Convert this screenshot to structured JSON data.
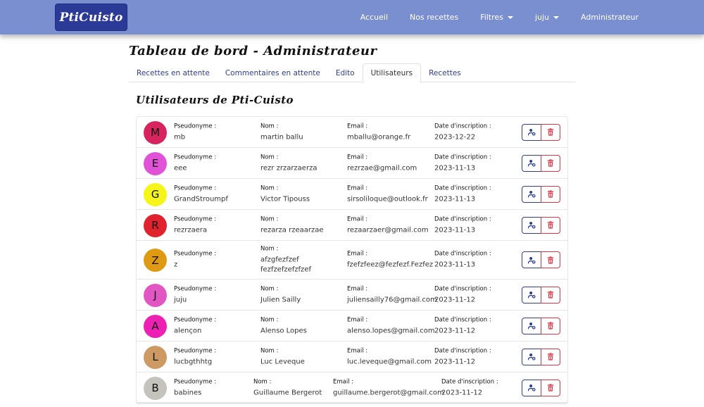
{
  "brand": "PtiCuisto",
  "nav": {
    "home": "Accueil",
    "recipes": "Nos recettes",
    "filters": "Filtres",
    "user": "juju",
    "admin": "Administrateur"
  },
  "page_title": "Tableau de bord - Administrateur",
  "tabs": [
    "Recettes en attente",
    "Commentaires en attente",
    "Edito",
    "Utilisateurs",
    "Recettes"
  ],
  "active_tab": "Utilisateurs",
  "section_title": "Utilisateurs de Pti-Cuisto",
  "labels": {
    "pseudo": "Pseudonyme :",
    "nom": "Nom :",
    "email": "Email :",
    "date": "Date d'inscription :"
  },
  "users": [
    {
      "initial": "M",
      "color": "#d6245f",
      "pseudo": "mb",
      "nom": "martin ballu",
      "email": "mballu@orange.fr",
      "date": "2023-12-22"
    },
    {
      "initial": "E",
      "color": "#e052d6",
      "pseudo": "eee",
      "nom": "rezr zrzarzaerza",
      "email": "rezrzae@gmail.com",
      "date": "2023-11-13"
    },
    {
      "initial": "G",
      "color": "#f5f51a",
      "pseudo": "GrandStroumpf",
      "nom": "Victor Tipouss",
      "email": "sirsoliloque@outlook.fr",
      "date": "2023-11-13"
    },
    {
      "initial": "R",
      "color": "#e0222e",
      "pseudo": "rezrzaera",
      "nom": "rezarza rzeaarzae",
      "email": "rezaarzaer@gmail.com",
      "date": "2023-11-13"
    },
    {
      "initial": "Z",
      "color": "#de9a12",
      "pseudo": "z",
      "nom": "afzgfezfzef fezfzefzefzfzef",
      "email": "fzefzfeez@fezfezf.Fezfez",
      "date": "2023-11-13"
    },
    {
      "initial": "J",
      "color": "#e256c3",
      "pseudo": "juju",
      "nom": "Julien Sailly",
      "email": "juliensailly76@gmail.com",
      "date": "2023-11-12"
    },
    {
      "initial": "A",
      "color": "#ec21b4",
      "pseudo": "alençon",
      "nom": "Alenso Lopes",
      "email": "alenso.lopes@gmail.com",
      "date": "2023-11-12"
    },
    {
      "initial": "L",
      "color": "#cc9a62",
      "pseudo": "lucbgthhtg",
      "nom": "Luc Leveque",
      "email": "luc.leveque@gmail.com",
      "date": "2023-11-12"
    },
    {
      "initial": "B",
      "color": "#c4c4bc",
      "pseudo": "babines",
      "nom": "Guillaume Bergerot",
      "email": "guillaume.bergerot@gmail.com",
      "date": "2023-11-12"
    }
  ],
  "icons": {
    "edit": "user-cog-icon",
    "delete": "trash-icon"
  },
  "colors": {
    "navbar": "#7a8fd0",
    "brand_bg": "#2b3a97",
    "edit_btn": "#2f3e8f",
    "delete_btn": "#dc3545"
  }
}
